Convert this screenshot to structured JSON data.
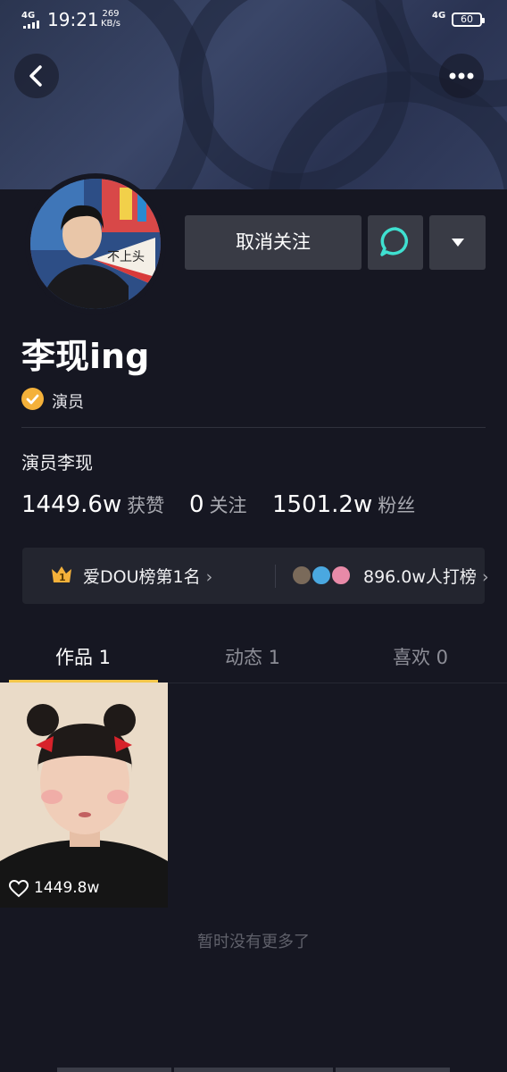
{
  "status_bar": {
    "network_left": "4G",
    "time": "19:21",
    "speed_value": "269",
    "speed_unit": "KB/s",
    "network_right": "4G",
    "battery": "60"
  },
  "header": {
    "back_icon": "chevron-left-icon",
    "more_icon": "more-horizontal-icon"
  },
  "profile": {
    "name": "李现ing",
    "verified_label": "演员",
    "bio": "演员李现",
    "avatar_fan_text": "不上头"
  },
  "actions": {
    "unfollow_label": "取消关注",
    "message_icon": "chat-bubble-icon",
    "dropdown_icon": "caret-down-icon"
  },
  "stats": [
    {
      "value": "1449.6w",
      "label": "获赞"
    },
    {
      "value": "0",
      "label": "关注"
    },
    {
      "value": "1501.2w",
      "label": "粉丝"
    }
  ],
  "rank_bar": {
    "crown_number": "1",
    "left_text": "爱DOU榜第1名",
    "right_text": "896.0w人打榜"
  },
  "tabs": [
    {
      "label": "作品 1",
      "active": true
    },
    {
      "label": "动态 1",
      "active": false
    },
    {
      "label": "喜欢 0",
      "active": false
    }
  ],
  "videos": [
    {
      "likes": "1449.8w"
    }
  ],
  "footer": {
    "no_more_text": "暂时没有更多了"
  },
  "colors": {
    "background": "#161722",
    "accent_yellow": "#f4c74a",
    "button_bg": "#393b45",
    "message_icon": "#3fe0d0"
  }
}
